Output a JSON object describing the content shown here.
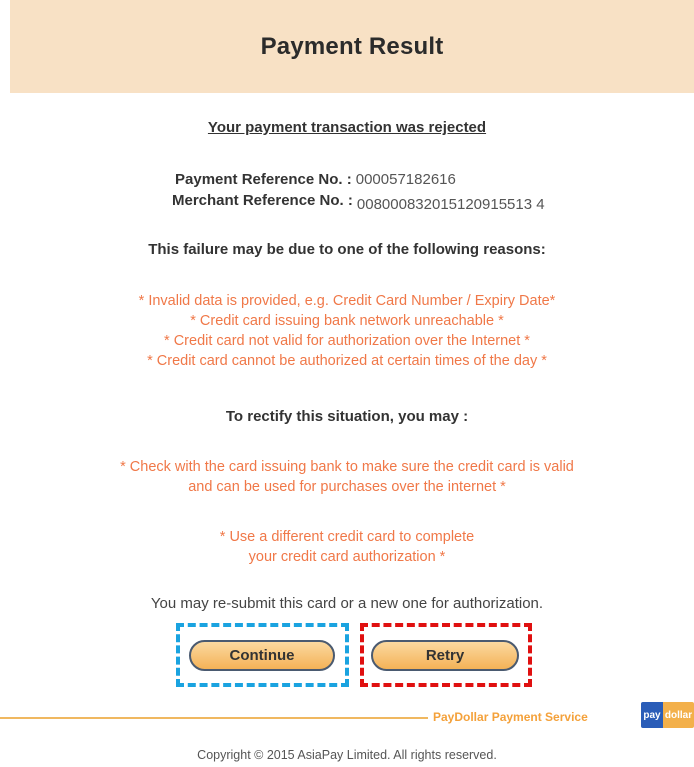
{
  "header": {
    "title": "Payment Result"
  },
  "status": {
    "message": "Your payment transaction was rejected"
  },
  "references": {
    "payment_label": "Payment Reference No. :",
    "payment_value": "000057182616",
    "merchant_label": "Merchant Reference No. :",
    "merchant_value": "008000832015120915513 4"
  },
  "reasons": {
    "title": "This failure may be due to one of the following reasons:",
    "items": [
      "* Invalid data is provided, e.g. Credit Card Number / Expiry Date*",
      "* Credit card issuing bank network unreachable *",
      "* Credit card not valid for authorization over the Internet *",
      "* Credit card cannot be authorized at certain times of the day *"
    ]
  },
  "rectify": {
    "title": "To rectify this situation, you may :",
    "fix1_line1": "* Check with the card issuing bank to make sure the credit card is valid",
    "fix1_line2": "and can be used for purchases over the internet *",
    "fix2_line1": "* Use a different credit card to complete",
    "fix2_line2": "your credit card authorization *"
  },
  "resubmit": {
    "message": "You may re-submit this card or a new one for authorization."
  },
  "buttons": {
    "continue_label": "Continue",
    "retry_label": "Retry"
  },
  "footer": {
    "brand": "PayDollar Payment Service",
    "logo_left": "pay",
    "logo_right": "dollar",
    "copyright": "Copyright © 2015 AsiaPay Limited. All rights reserved."
  },
  "colors": {
    "header_bg": "#f8e1c5",
    "reason_text": "#f07848",
    "highlight_continue": "#1aa3e0",
    "highlight_retry": "#e01010"
  }
}
